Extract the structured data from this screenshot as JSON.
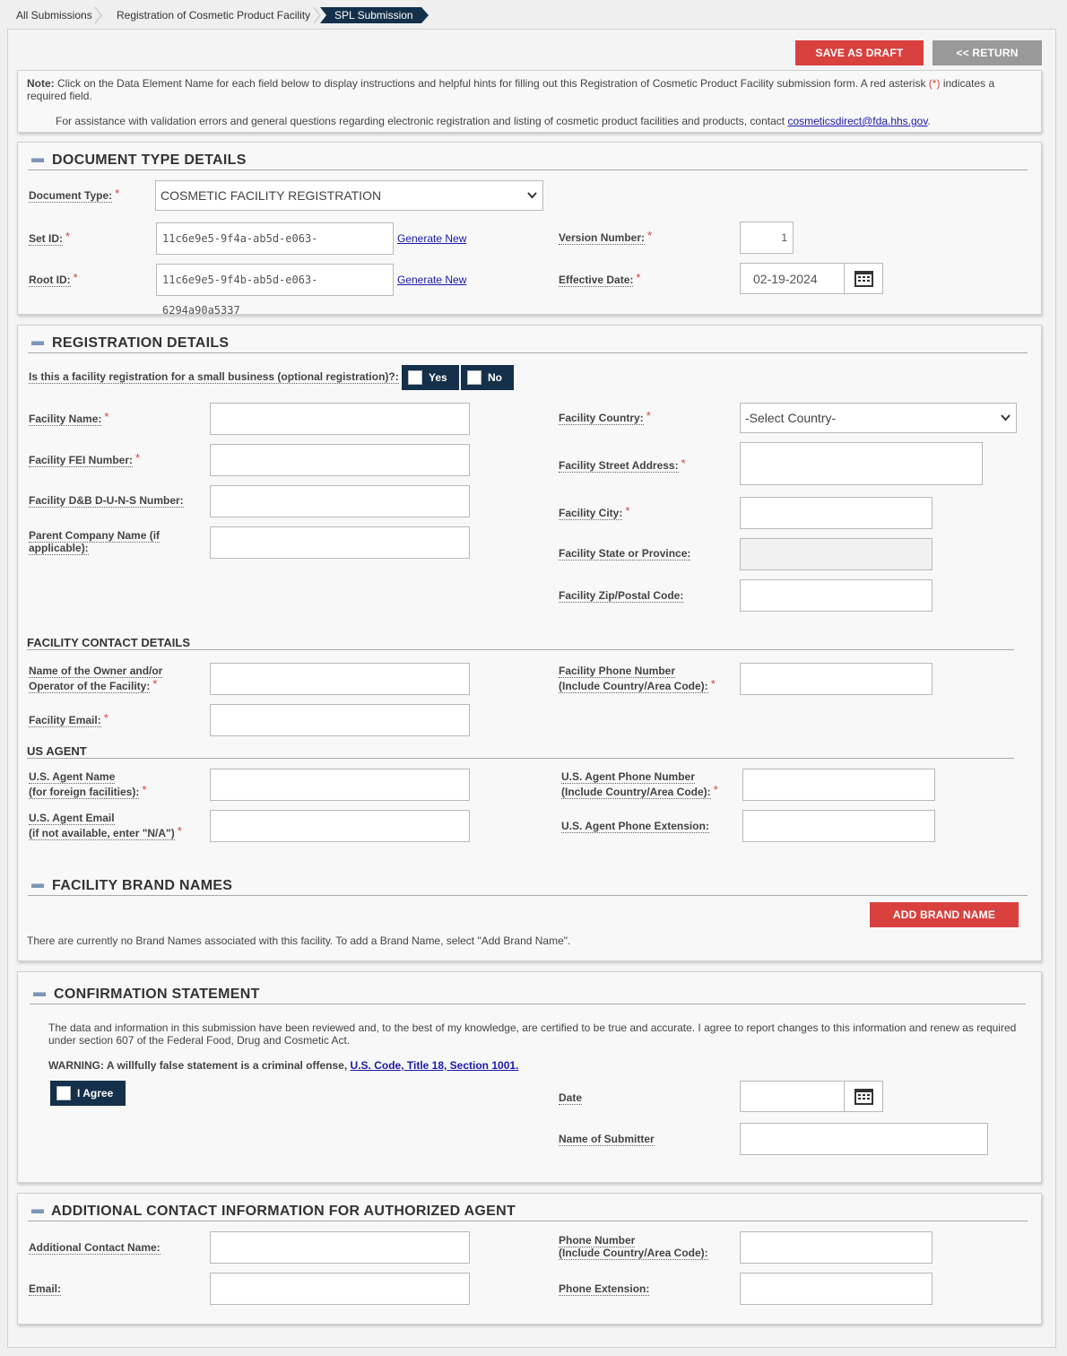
{
  "breadcrumb": [
    "All Submissions",
    "Registration of Cosmetic Product Facility",
    "SPL Submission"
  ],
  "actions": {
    "save_draft": "SAVE AS DRAFT",
    "return": "<< RETURN"
  },
  "note": {
    "label": "Note:",
    "text1": "Click on the Data Element Name for each field below to display instructions and helpful hints for filling out this Registration of Cosmetic Product Facility submission form. A red asterisk",
    "asterisk": "(*)",
    "text2": "indicates a",
    "text3": "required field.",
    "assist": "For assistance with validation errors and general questions regarding electronic registration and listing of cosmetic product facilities and products, contact",
    "email": "cosmeticsdirect@fda.hhs.gov",
    "period": "."
  },
  "doc_type": {
    "title": "DOCUMENT TYPE DETAILS",
    "document_type_label": "Document Type:",
    "document_type_value": "COSMETIC FACILITY REGISTRATION",
    "set_id_label": "Set ID:",
    "set_id_value": "11c6e9e5-9f4a-ab5d-e063-6294a90a5337",
    "root_id_label": "Root ID:",
    "root_id_value": "11c6e9e5-9f4b-ab5d-e063-6294a90a5337",
    "generate_new": "Generate New",
    "version_label": "Version Number:",
    "version_value": "1",
    "effective_label": "Effective Date:",
    "effective_value": "02-19-2024"
  },
  "registration": {
    "title": "REGISTRATION DETAILS",
    "small_business_q": "Is this a facility registration for a small business (optional registration)?:",
    "yes": "Yes",
    "no": "No",
    "facility_name": "Facility Name:",
    "fei": "Facility FEI Number:",
    "duns": "Facility D&B D-U-N-S Number:",
    "parent1": "Parent Company Name (if",
    "parent2": "applicable):",
    "country": "Facility Country:",
    "country_value": "-Select Country-",
    "street": "Facility Street Address:",
    "city": "Facility City:",
    "state": "Facility State or Province:",
    "zip": "Facility Zip/Postal Code:",
    "contact_title": "FACILITY CONTACT DETAILS",
    "owner1": "Name of the Owner and/or",
    "owner2": "Operator of the Facility:",
    "email": "Facility Email:",
    "phone1": "Facility Phone Number",
    "phone2": "(Include Country/Area Code):",
    "agent_title": "US AGENT",
    "agent_name1": "U.S. Agent Name",
    "agent_name2": "(for foreign facilities):",
    "agent_email1": "U.S. Agent Email",
    "agent_email2": "(if not available, enter \"N/A\")",
    "agent_phone1": "U.S. Agent Phone Number",
    "agent_phone2": "(Include Country/Area Code):",
    "agent_ext": "U.S. Agent Phone Extension:",
    "brand_title": "FACILITY BRAND NAMES",
    "add_brand": "ADD BRAND NAME",
    "no_brands": "There are currently no Brand Names associated with this facility. To add a Brand Name, select \"Add Brand Name\"."
  },
  "confirmation": {
    "title": "CONFIRMATION STATEMENT",
    "statement1": "The data and information in this submission have been reviewed and, to the best of my knowledge, are certified to be true and accurate. I agree to report changes to this information and renew as required",
    "statement2": "under section 607 of the Federal Food, Drug and Cosmetic Act.",
    "warning": "WARNING: A willfully false statement is a criminal offense,",
    "warning_link": "U.S. Code, Title 18, Section 1001.",
    "agree": "I Agree",
    "date": "Date",
    "submitter": "Name of Submitter"
  },
  "additional": {
    "title": "ADDITIONAL CONTACT INFORMATION FOR AUTHORIZED AGENT",
    "name": "Additional Contact Name:",
    "email": "Email:",
    "phone1": "Phone Number",
    "phone2": "(Include Country/Area Code):",
    "ext": "Phone Extension:"
  },
  "colors": {
    "accent_red": "#d9413f",
    "navy": "#14304a",
    "grey_button": "#999999"
  },
  "icons": [
    "minus-icon",
    "calendar-icon",
    "chevron-down-icon",
    "checkbox-icon"
  ]
}
